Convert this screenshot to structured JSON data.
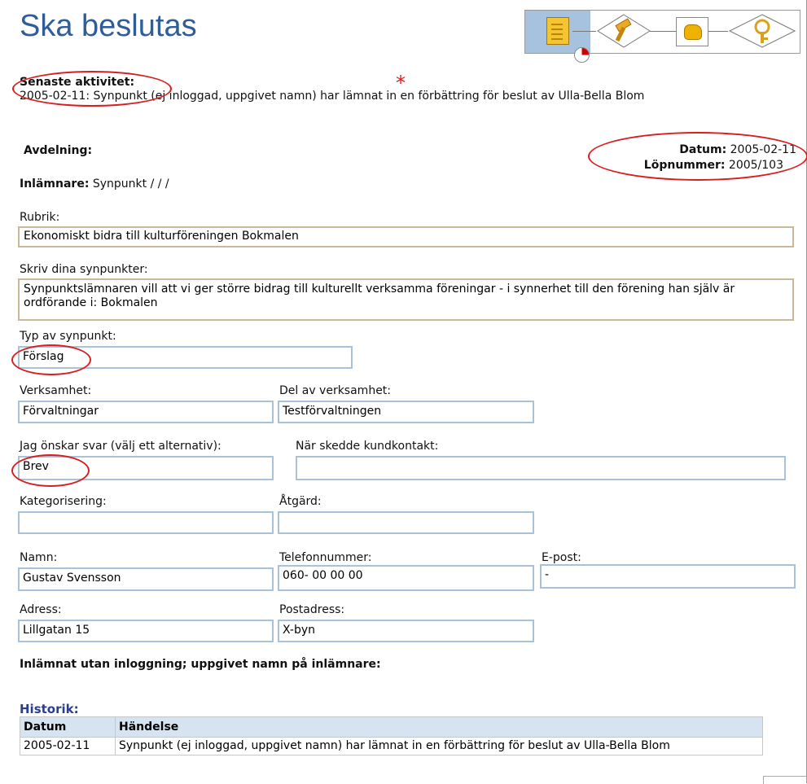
{
  "page_title": "Ska beslutas",
  "latest_activity": {
    "label": "Senaste aktivitet:",
    "date": "2005-02-11",
    "text": ": Synpunkt (ej inloggad, uppgivet namn) har lämnat in en förbättring för beslut av Ulla-Bella Blom"
  },
  "department": {
    "label": "Avdelning:"
  },
  "meta": {
    "date_label": "Datum:",
    "date_value": "2005-02-11",
    "serial_label": "Löpnummer:",
    "serial_value": "2005/103"
  },
  "submitter": {
    "label": "Inlämnare:",
    "value": "Synpunkt / / /"
  },
  "fields": {
    "rubrik": {
      "label": "Rubrik:",
      "value": "Ekonomiskt bidra till kulturföreningen Bokmalen"
    },
    "synpunkter": {
      "label": "Skriv dina synpunkter:",
      "value": "Synpunktslämnaren vill att vi ger större bidrag till kulturellt verksamma föreningar - i synnerhet till den förening han själv är ordförande i: Bokmalen"
    },
    "typ": {
      "label": "Typ av synpunkt:",
      "value": "Förslag"
    },
    "verksamhet": {
      "label": "Verksamhet:",
      "value": "Förvaltningar"
    },
    "del": {
      "label": "Del av verksamhet:",
      "value": "Testförvaltningen"
    },
    "svar": {
      "label": "Jag önskar svar (välj ett alternativ):",
      "value": "Brev"
    },
    "kontakt": {
      "label": "När skedde kundkontakt:",
      "value": ""
    },
    "kategorisering": {
      "label": "Kategorisering:",
      "value": ""
    },
    "atgard": {
      "label": "Åtgärd:",
      "value": ""
    },
    "namn": {
      "label": "Namn:",
      "value": "Gustav Svensson"
    },
    "telefon": {
      "label": "Telefonnummer:",
      "value": "060- 00 00 00"
    },
    "epost": {
      "label": "E-post:",
      "value": "-"
    },
    "adress": {
      "label": "Adress:",
      "value": "Lillgatan 15"
    },
    "postadress": {
      "label": "Postadress:",
      "value": "X-byn"
    }
  },
  "submitted_note": "Inlämnat utan inloggning; uppgivet namn på inlämnare:",
  "history": {
    "title": "Historik:",
    "columns": [
      "Datum",
      "Händelse"
    ],
    "rows": [
      {
        "date": "2005-02-11",
        "event": "Synpunkt (ej inloggad, uppgivet namn) har lämnat in en förbättring för beslut av Ulla-Bella Blom"
      }
    ]
  },
  "annotation_color": "#d81e1e",
  "workflow": {
    "steps": [
      "document-icon",
      "gavel-icon",
      "hand-icon",
      "key-icon"
    ],
    "active_step": "document-icon"
  }
}
